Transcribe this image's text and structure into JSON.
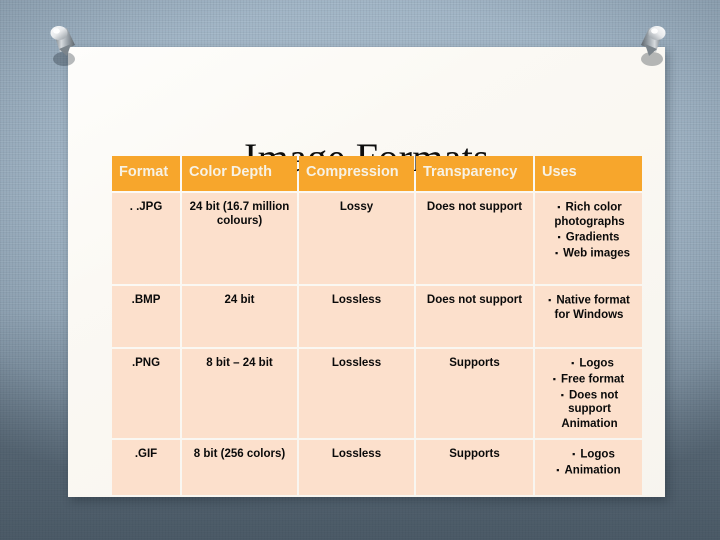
{
  "slide": {
    "title": "Image Formats",
    "background_color": "#9fb4c5",
    "paper_color": "#fbf9f4",
    "accent_color": "#f7a62c",
    "cell_color": "#fce0cc",
    "pin_left_name": "push-pin",
    "pin_right_name": "push-pin"
  },
  "table": {
    "headers": [
      "Format",
      "Color Depth",
      "Compression",
      "Transparency",
      "Uses"
    ],
    "rows": [
      {
        "format": ". .JPG",
        "color_depth": "24 bit (16.7 million colours)",
        "compression": "Lossy",
        "transparency": "Does not support",
        "uses": [
          "Rich color photographs",
          "Gradients",
          "Web images"
        ]
      },
      {
        "format": ".BMP",
        "color_depth": "24 bit",
        "compression": "Lossless",
        "transparency": "Does not support",
        "uses": [
          "Native format for Windows"
        ]
      },
      {
        "format": ".PNG",
        "color_depth": "8 bit – 24 bit",
        "compression": "Lossless",
        "transparency": "Supports",
        "uses": [
          "Logos",
          "Free format",
          "Does not support Animation"
        ]
      },
      {
        "format": ".GIF",
        "color_depth": "8 bit (256 colors)",
        "compression": "Lossless",
        "transparency": "Supports",
        "uses": [
          "Logos",
          "Animation"
        ]
      }
    ],
    "bullet_glyph": "▪"
  }
}
